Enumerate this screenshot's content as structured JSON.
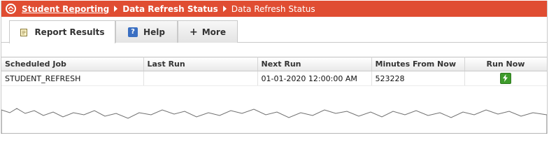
{
  "breadcrumb": {
    "items": [
      "Student Reporting",
      "Data Refresh Status",
      "Data Refresh Status"
    ]
  },
  "tabs": [
    {
      "label": "Report Results",
      "icon": "report-icon",
      "active": true
    },
    {
      "label": "Help",
      "icon": "help-icon",
      "active": false
    },
    {
      "label": "More",
      "icon": "plus-icon",
      "active": false
    }
  ],
  "table": {
    "headers": [
      "Scheduled Job",
      "Last Run",
      "Next Run",
      "Minutes From Now",
      "Run Now"
    ],
    "rows": [
      {
        "job": "STUDENT_REFRESH",
        "last_run": "",
        "next_run": "01-01-2020 12:00:00 AM",
        "minutes": "523228",
        "run_icon": "lightning-run-icon"
      }
    ]
  },
  "colors": {
    "titlebar": "#e04d32",
    "run_button": "#3e9b2b",
    "help_icon": "#3a6fc2"
  }
}
